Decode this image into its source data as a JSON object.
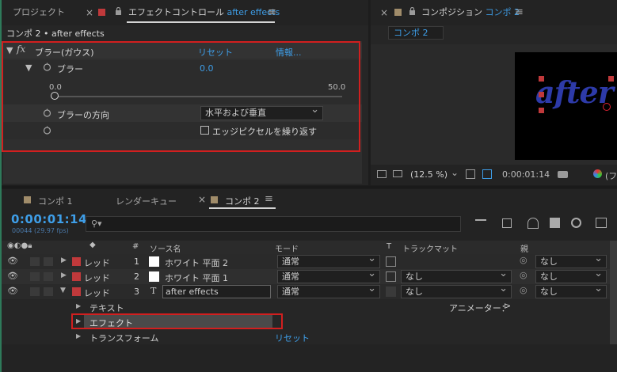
{
  "effect_panel": {
    "tabs": [
      {
        "label": "プロジェクト"
      },
      {
        "label": "エフェクトコントロール",
        "comp": "after effects"
      }
    ],
    "close_glyph": "×",
    "breadcrumb": "コンポ 2 • after effects",
    "effect": {
      "fx": "fx",
      "name": "ブラー(ガウス)",
      "reset": "リセット",
      "info": "情報...",
      "blur_label": "ブラー",
      "blur_value": "0.0",
      "slider_min": "0.0",
      "slider_max": "50.0",
      "slider_level": 0,
      "direction_label": "ブラーの方向",
      "direction_value": "水平および垂直",
      "edge_label": "エッジピクセルを繰り返す"
    }
  },
  "comp_panel": {
    "tab_prefix": "コンポジション",
    "tab_comp": "コンポ 2",
    "inner_tab": "コンポ 2",
    "preview_text": "after ef",
    "zoom": "(12.5 %)",
    "timecode": "0:00:01:14",
    "cut_text": "(フ"
  },
  "timeline": {
    "tabs": [
      "コンポ 1",
      "レンダーキュー",
      "コンポ 2"
    ],
    "timecode": "0:00:01:14",
    "frame_info": "00044 (29.97 fps)",
    "search_placeholder": "",
    "headers": {
      "num": "#",
      "source": "ソース名",
      "mode": "モード",
      "t": "T",
      "trackmatte": "トラックマット",
      "parent": "親"
    },
    "layers": [
      {
        "label": "レッド",
        "num": "1",
        "name": "ホワイト 平面 2",
        "mode": "通常",
        "matte": "",
        "parent": "なし"
      },
      {
        "label": "レッド",
        "num": "2",
        "name": "ホワイト 平面 1",
        "mode": "通常",
        "matte": "なし",
        "parent": "なし"
      },
      {
        "label": "レッド",
        "num": "3",
        "name": "after effects",
        "mode": "通常",
        "matte": "なし",
        "parent": "なし"
      }
    ],
    "sub": {
      "text": "テキスト",
      "animator": "アニメーター：",
      "effect": "エフェクト",
      "transform": "トランスフォーム",
      "reset": "リセット"
    }
  },
  "colors": {
    "accent": "#3e9ee8",
    "red_label": "#c0393b",
    "highlight": "#d21f1f",
    "label_tan": "#a08c6a"
  }
}
